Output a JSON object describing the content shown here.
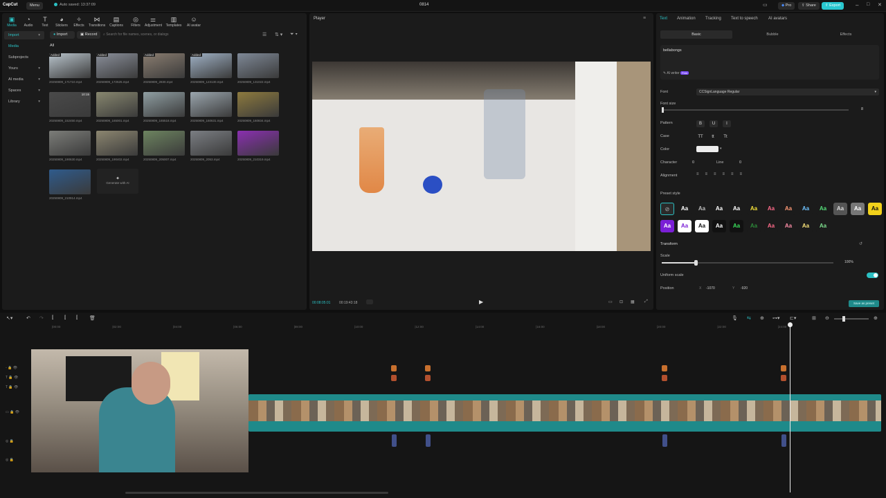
{
  "titlebar": {
    "logo": "CapCut",
    "menu": "Menu",
    "autosave": "Auto saved: 13:37:09",
    "project_name": "0814",
    "pro": "Pro",
    "share": "Share",
    "export": "Export"
  },
  "toolbar": [
    {
      "label": "Media",
      "icon": "media-icon",
      "active": true
    },
    {
      "label": "Audio",
      "icon": "audio-icon"
    },
    {
      "label": "Text",
      "icon": "text-icon"
    },
    {
      "label": "Stickers",
      "icon": "stickers-icon"
    },
    {
      "label": "Effects",
      "icon": "effects-icon"
    },
    {
      "label": "Transitions",
      "icon": "transitions-icon"
    },
    {
      "label": "Captions",
      "icon": "captions-icon"
    },
    {
      "label": "Filters",
      "icon": "filters-icon"
    },
    {
      "label": "Adjustment",
      "icon": "adjustment-icon"
    },
    {
      "label": "Templates",
      "icon": "templates-icon"
    },
    {
      "label": "AI avatar",
      "icon": "ai-avatar-icon"
    }
  ],
  "sidebar": [
    {
      "label": "Import",
      "active": true
    },
    {
      "label": "Media"
    },
    {
      "label": "Subprojects"
    },
    {
      "label": "Yours"
    },
    {
      "label": "AI media"
    },
    {
      "label": "Spaces"
    },
    {
      "label": "Library"
    }
  ],
  "media_bar": {
    "import": "Import",
    "record": "Record",
    "search_placeholder": "Search for file names, scenes, or dialogs",
    "all": "All"
  },
  "media_items": [
    {
      "name": "20250809_171710.mp4",
      "badge": "Added",
      "color": "#b9c4cc"
    },
    {
      "name": "20250809_172525.mp4",
      "badge": "Added",
      "color": "#8a8f9a"
    },
    {
      "name": "20250809_2830.mp4",
      "badge": "Added",
      "color": "#8a7d70"
    },
    {
      "name": "20250809_123130.mp4",
      "badge": "Added",
      "color": "#9fb1c5"
    },
    {
      "name": "20250809_131022.mp4",
      "badge": "",
      "color": "#7e8896"
    },
    {
      "name": "20250809_152450.mp4",
      "badge": "",
      "duration": "10:15",
      "color": "#4a4a4a"
    },
    {
      "name": "20250809_165001.mp4",
      "badge": "",
      "color": "#88876f"
    },
    {
      "name": "20250809_165518.mp4",
      "badge": "",
      "color": "#8f9ea2"
    },
    {
      "name": "20250809_160631.mp4",
      "badge": "",
      "color": "#9aa5ad"
    },
    {
      "name": "20250809_160834.mp4",
      "badge": "",
      "color": "#8d7a3e"
    },
    {
      "name": "20250809_190630.mp4",
      "badge": "",
      "color": "#7c7d79"
    },
    {
      "name": "20250809_190402.mp4",
      "badge": "",
      "color": "#8c8670"
    },
    {
      "name": "20250809_205007.mp4",
      "badge": "",
      "color": "#6d8460"
    },
    {
      "name": "20250809_2053.mp4",
      "badge": "",
      "color": "#7b7e83"
    },
    {
      "name": "20250809_210319.mp4",
      "badge": "",
      "color": "#8a2fb0"
    },
    {
      "name": "20250809_210914.mp4",
      "badge": "",
      "color": "#2f5b8c"
    }
  ],
  "generate_ai": "Generate with AI",
  "player": {
    "title": "Player",
    "current_time": "00:08:05:01",
    "total_time": "00:19:43:18"
  },
  "right_tabs": [
    "Text",
    "Animation",
    "Tracking",
    "Text to speech",
    "AI avatars"
  ],
  "sub_tabs": [
    "Basic",
    "Bubble",
    "Effects"
  ],
  "text_content": "bellabongs",
  "ai_writer": "AI writer",
  "ai_writer_badge": "Free",
  "props": {
    "font_label": "Font",
    "font_value": "CCSignLanguage Regular",
    "font_size_label": "Font size",
    "font_size_value": "8",
    "pattern_label": "Pattern",
    "case_label": "Case",
    "color_label": "Color",
    "character_label": "Character",
    "character_value": "0",
    "line_label": "Line",
    "line_value": "0",
    "alignment_label": "Alignment",
    "preset_label": "Preset style",
    "transform_label": "Transform",
    "scale_label": "Scale",
    "scale_value": "100%",
    "uniform_label": "Uniform scale",
    "position_label": "Position",
    "pos_x_label": "X",
    "pos_x": "-1070",
    "pos_y_label": "Y",
    "pos_y": "-920",
    "save_preset": "Save as preset"
  },
  "pattern_buttons": [
    "B",
    "U",
    "I"
  ],
  "case_buttons": [
    "TT",
    "tt",
    "Tt"
  ],
  "presets_row1": [
    {
      "t": "",
      "bg": "#2a2a2a",
      "fg": "#888"
    },
    {
      "t": "Aa",
      "bg": "#1b1b1b",
      "fg": "#fff"
    },
    {
      "t": "Aa",
      "bg": "#1b1b1b",
      "fg": "#bbb"
    },
    {
      "t": "Aa",
      "bg": "#1b1b1b",
      "fg": "#fff"
    },
    {
      "t": "Aa",
      "bg": "#1b1b1b",
      "fg": "#fff"
    },
    {
      "t": "Aa",
      "bg": "#1b1b1b",
      "fg": "#f5e23a"
    },
    {
      "t": "Aa",
      "bg": "#1b1b1b",
      "fg": "#ff6b8a"
    },
    {
      "t": "Aa",
      "bg": "#1b1b1b",
      "fg": "#ff9a76"
    },
    {
      "t": "Aa",
      "bg": "#1b1b1b",
      "fg": "#6fc3ff"
    },
    {
      "t": "Aa",
      "bg": "#1b1b1b",
      "fg": "#55e07a"
    },
    {
      "t": "Aa",
      "bg": "#555",
      "fg": "#ddd"
    },
    {
      "t": "Aa",
      "bg": "#777",
      "fg": "#fff"
    },
    {
      "t": "Aa",
      "bg": "#f2d21b",
      "fg": "#111"
    }
  ],
  "presets_row2": [
    {
      "t": "Aa",
      "bg": "#7a1fd6",
      "fg": "#fff"
    },
    {
      "t": "Aa",
      "bg": "#fff",
      "fg": "#7a1fd6"
    },
    {
      "t": "Aa",
      "bg": "#fff",
      "fg": "#111"
    },
    {
      "t": "Aa",
      "bg": "#111",
      "fg": "#fff"
    },
    {
      "t": "Aa",
      "bg": "#111",
      "fg": "#3ae05c"
    },
    {
      "t": "Aa",
      "bg": "#1b1b1b",
      "fg": "#2d8a3a"
    },
    {
      "t": "Aa",
      "bg": "#1b1b1b",
      "fg": "#ff6b8a"
    },
    {
      "t": "Aa",
      "bg": "#1b1b1b",
      "fg": "#ff8fa8"
    },
    {
      "t": "Aa",
      "bg": "#1b1b1b",
      "fg": "#f8e27a"
    },
    {
      "t": "Aa",
      "bg": "#1b1b1b",
      "fg": "#7ee08f"
    }
  ],
  "timeline_ticks": [
    "|00:00",
    "|02:00",
    "|04:00",
    "|06:00",
    "|08:00",
    "|10:00",
    "|12:00",
    "|14:00",
    "|16:00",
    "|18:00",
    "|20:00",
    "|22:00",
    "|24:00"
  ],
  "colors": {
    "accent": "#2bc0c3",
    "export": "#29c7cf",
    "pro": "#3a6bd6",
    "clip_track": "#1f8a8a",
    "marker": "#c8702e"
  }
}
